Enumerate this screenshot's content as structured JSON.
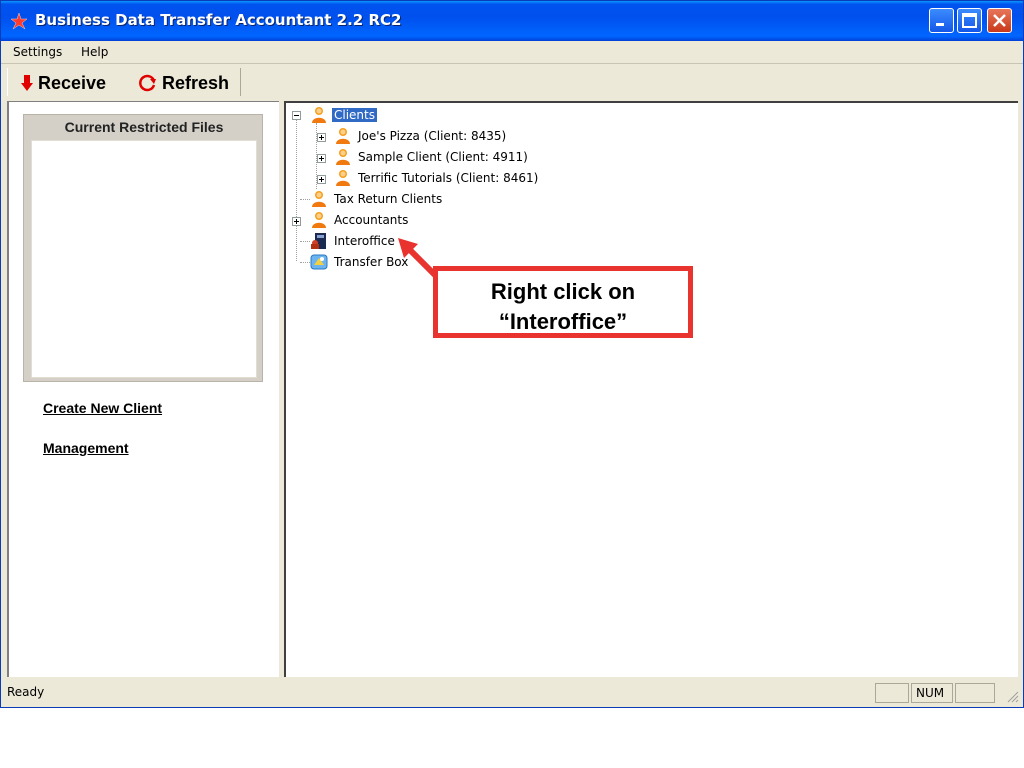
{
  "window": {
    "title": "Business Data Transfer Accountant 2.2 RC2",
    "title_color": "#ffffff",
    "titlebar_color": "#0054e3"
  },
  "menu": {
    "items": [
      "Settings",
      "Help"
    ]
  },
  "toolbar": {
    "receive_label": "Receive",
    "refresh_label": "Refresh"
  },
  "left_pane": {
    "restricted_title": "Current Restricted Files",
    "links": [
      "Create New Client",
      "Management"
    ]
  },
  "tree": {
    "root": "Clients",
    "clients": [
      "Joe's Pizza (Client: 8435)",
      "Sample Client (Client: 4911)",
      "Terrific Tutorials (Client: 8461)"
    ],
    "tax_return": "Tax Return Clients",
    "accountants": "Accountants",
    "interoffice": "Interoffice",
    "transfer_box": "Transfer Box",
    "selection_color": "#316ac5"
  },
  "status": {
    "text": "Ready",
    "num": "NUM"
  },
  "callout": {
    "line1": "Right click on",
    "line2": "“Interoffice”",
    "border_color": "#e8332e"
  },
  "icons": [
    "app-icon",
    "minimize-icon",
    "maximize-icon",
    "close-icon",
    "receive-arrow-icon",
    "refresh-icon",
    "user-icon",
    "interoffice-icon",
    "transfer-box-icon",
    "resize-grip-icon"
  ]
}
